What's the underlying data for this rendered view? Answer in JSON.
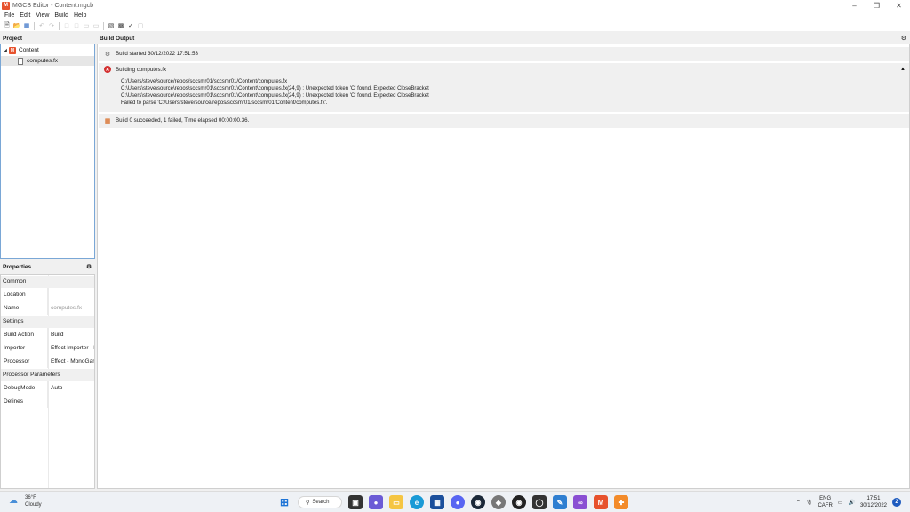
{
  "window": {
    "title": "MGCB Editor - Content.mgcb",
    "app_icon": "monogame-logo-icon",
    "controls": [
      "minimize",
      "maximize",
      "close"
    ]
  },
  "menu": [
    "File",
    "Edit",
    "View",
    "Build",
    "Help"
  ],
  "toolbar": {
    "buttons": [
      {
        "name": "new-icon",
        "enabled": true
      },
      {
        "name": "open-icon",
        "enabled": true
      },
      {
        "name": "save-icon",
        "enabled": true
      },
      {
        "name": "undo-icon",
        "enabled": false
      },
      {
        "name": "redo-icon",
        "enabled": false
      },
      {
        "name": "add-item-icon",
        "enabled": false
      },
      {
        "name": "new-item-icon",
        "enabled": false
      },
      {
        "name": "new-folder-icon",
        "enabled": false
      },
      {
        "name": "existing-folder-icon",
        "enabled": false
      },
      {
        "name": "build-icon",
        "enabled": true
      },
      {
        "name": "rebuild-icon",
        "enabled": true
      },
      {
        "name": "clean-icon",
        "enabled": true
      },
      {
        "name": "cancel-build-icon",
        "enabled": false
      }
    ]
  },
  "project": {
    "header": "Project",
    "root": "Content",
    "items": [
      "computes.fx"
    ]
  },
  "properties": {
    "header": "Properties",
    "categories": [
      {
        "label": "Common",
        "rows": [
          {
            "name": "Location",
            "value": ""
          },
          {
            "name": "Name",
            "value": "computes.fx",
            "dim": true
          }
        ]
      },
      {
        "label": "Settings",
        "rows": [
          {
            "name": "Build Action",
            "value": "Build"
          },
          {
            "name": "Importer",
            "value": "Effect Importer - M"
          },
          {
            "name": "Processor",
            "value": "Effect - MonoGame"
          }
        ]
      },
      {
        "label": "Processor Parameters",
        "rows": [
          {
            "name": "DebugMode",
            "value": "Auto"
          },
          {
            "name": "Defines",
            "value": ""
          }
        ]
      }
    ]
  },
  "output": {
    "header": "Build Output",
    "started": "Build started 30/12/2022 17:51:53",
    "building": "Building computes.fx",
    "details": [
      "C:/Users/steve/source/repos/sccsmr01/sccsmr01/Content/computes.fx",
      "C:\\Users\\steve\\source\\repos\\sccsmr01\\sccsmr01\\Content\\computes.fx(24,9) : Unexpected token 'C' found. Expected CloseBracket",
      "C:\\Users\\steve\\source\\repos\\sccsmr01\\sccsmr01\\Content\\computes.fx(24,9) : Unexpected token 'C' found. Expected CloseBracket",
      "Failed to parse 'C:/Users/steve/source/repos/sccsmr01/sccsmr01/Content/computes.fx'."
    ],
    "summary": "Build 0 succeeded, 1 failed, Time elapsed 00:00:00.36."
  },
  "taskbar": {
    "weather_temp": "36°F",
    "weather_desc": "Cloudy",
    "search_label": "Search",
    "lang_top": "ENG",
    "lang_bottom": "CAFR",
    "time": "17:51",
    "date": "30/12/2022"
  }
}
